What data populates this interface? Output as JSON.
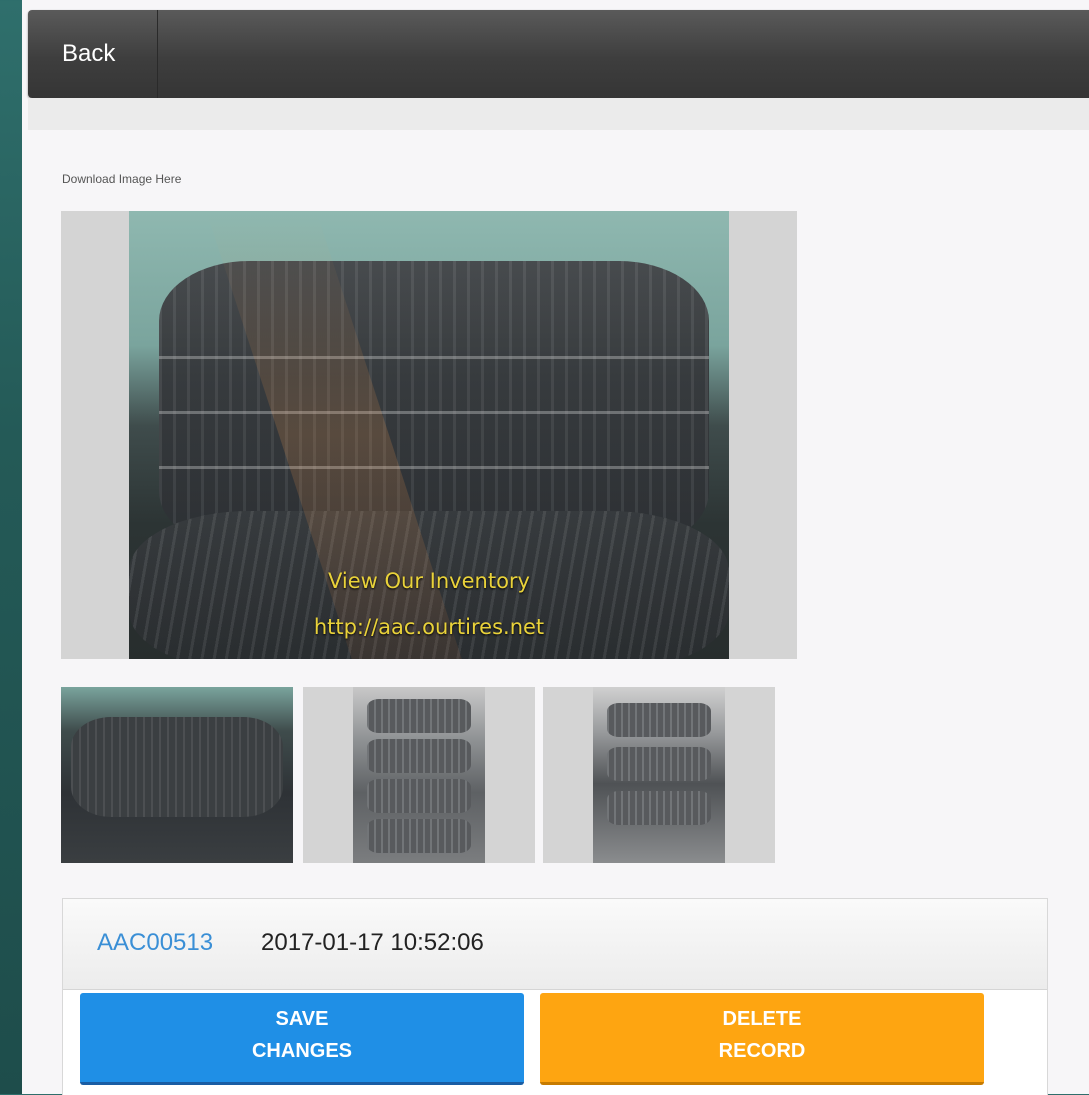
{
  "header": {
    "back_label": "Back"
  },
  "gallery": {
    "download_label": "Download Image Here",
    "watermark_line1": "View Our Inventory",
    "watermark_line2": "http://aac.ourtires.net",
    "thumbnails": [
      "tire-photo-1",
      "tire-photo-2",
      "tire-photo-3"
    ]
  },
  "record": {
    "id": "AAC00513",
    "timestamp": "2017-01-17 10:52:06"
  },
  "actions": {
    "save_line1": "SAVE",
    "save_line2": "CHANGES",
    "delete_line1": "DELETE",
    "delete_line2": "RECORD"
  },
  "colors": {
    "save": "#1f8fe6",
    "delete": "#fea511",
    "link": "#3a8fd6",
    "watermark": "#e9d23a"
  }
}
